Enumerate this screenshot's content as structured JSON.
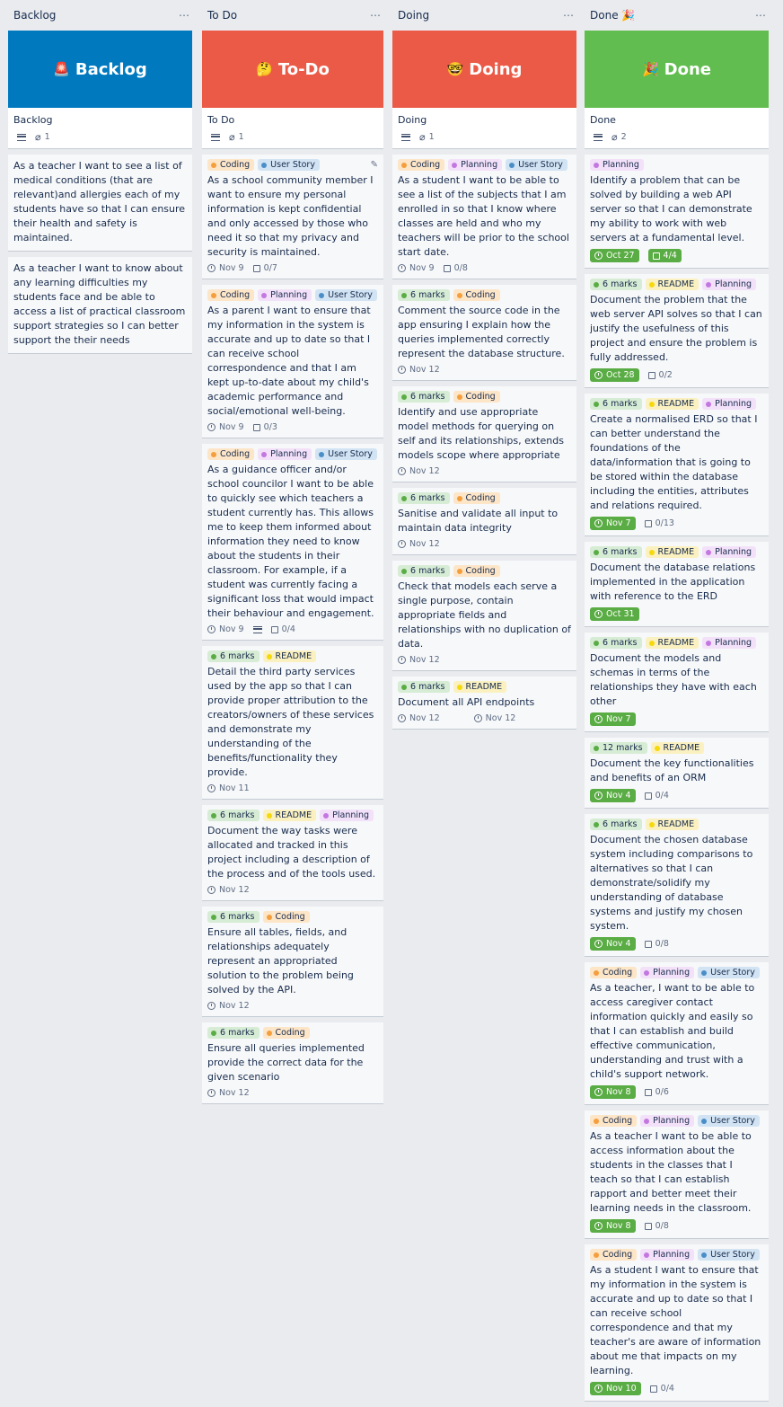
{
  "columns": [
    {
      "name": "Backlog",
      "cover": {
        "emoji": "🚨",
        "title": "Backlog",
        "color": "#0079bf"
      },
      "head_card": {
        "title": "Backlog",
        "attachments": "1"
      },
      "cards": [
        {
          "title": "As a teacher I want to see a list of medical conditions (that are relevant)and allergies each of my students have so that I can ensure their health and safety is maintained."
        },
        {
          "title": "As a teacher I want to know about any learning difficulties my students face and be able to access a list of practical classroom support strategies so I can better support the their needs"
        }
      ]
    },
    {
      "name": "To Do",
      "cover": {
        "emoji": "🤔",
        "title": "To-Do",
        "color": "#eb5a46"
      },
      "head_card": {
        "title": "To Do",
        "attachments": "1"
      },
      "cards": [
        {
          "labels": [
            "Coding",
            "User Story"
          ],
          "title": "As a school community member I want to ensure my personal information is kept confidential and only accessed by those who need it so that my privacy and security is maintained.",
          "date": "Nov 9",
          "checklist": "0/7"
        },
        {
          "labels": [
            "Coding",
            "Planning",
            "User Story"
          ],
          "title": "As a parent I want to ensure that my information in the system is accurate and up to date so that I can receive school correspondence and that I am kept up-to-date about my child's academic performance and social/emotional well-being.",
          "date": "Nov 9",
          "checklist": "0/3"
        },
        {
          "labels": [
            "Coding",
            "Planning",
            "User Story"
          ],
          "title": "As a guidance officer and/or school councilor I want to be able to quickly see which teachers a student currently has. This allows me to keep them informed about information they need to know about the students in their classroom. For example, if a student was currently facing a significant loss that would impact their behaviour and engagement.",
          "date": "Nov 9",
          "checklist": "0/4"
        },
        {
          "labels": [
            "6 marks",
            "README"
          ],
          "title": "Detail the third party services used by the app so that I can provide proper attribution to the creators/owners of these services and demonstrate my understanding of the benefits/functionality they provide.",
          "date": "Nov 11"
        },
        {
          "labels": [
            "6 marks",
            "README",
            "Planning"
          ],
          "title": "Document the way tasks were allocated and tracked in this project including a description of the process and of the tools used.",
          "date": "Nov 12"
        },
        {
          "labels": [
            "6 marks",
            "Coding"
          ],
          "title": "Ensure all tables, fields, and relationships adequately represent an appropriated solution to the problem being solved by the API.",
          "date": "Nov 12"
        },
        {
          "labels": [
            "6 marks",
            "Coding"
          ],
          "title": "Ensure all queries implemented provide the correct data for the given scenario",
          "date": "Nov 12"
        }
      ]
    },
    {
      "name": "Doing",
      "cover": {
        "emoji": "🤓",
        "title": "Doing",
        "color": "#eb5a46"
      },
      "head_card": {
        "title": "Doing",
        "attachments": "1"
      },
      "cards": [
        {
          "labels": [
            "Coding",
            "Planning",
            "User Story"
          ],
          "title": "As a student I want to be able to see a list of the subjects that I am enrolled in so that I know where classes are held and who my teachers will be prior to the school start date.",
          "date": "Nov 9",
          "checklist": "0/8"
        },
        {
          "labels": [
            "6 marks",
            "Coding"
          ],
          "title": "Comment the source code in the app ensuring I explain how the queries implemented correctly represent the database structure.",
          "date": "Nov 12"
        },
        {
          "labels": [
            "6 marks",
            "Coding"
          ],
          "title": "Identify and use appropriate model methods for querying on self and its relationships, extends models scope where appropriate",
          "date": "Nov 12"
        },
        {
          "labels": [
            "6 marks",
            "Coding"
          ],
          "title": "Sanitise and validate all input to maintain data integrity",
          "date": "Nov 12"
        },
        {
          "labels": [
            "6 marks",
            "Coding"
          ],
          "title": "Check that models each serve a single purpose, contain appropriate fields and relationships with no duplication of data.",
          "date": "Nov 12"
        },
        {
          "labels": [
            "6 marks",
            "README"
          ],
          "title": "Document all API endpoints",
          "date": "Nov 12",
          "date2": "Nov 12"
        }
      ]
    },
    {
      "name": "Done 🎉",
      "cover": {
        "emoji": "🎉",
        "title": "Done",
        "color": "#61bd4f"
      },
      "head_card": {
        "title": "Done",
        "attachments": "2"
      },
      "cards": [
        {
          "labels": [
            "Planning"
          ],
          "title": "Identify a problem that can be solved by building a web API server so that I can demonstrate my ability to work with web servers at a fundamental level.",
          "date": "Oct 27",
          "checklist": "4/4",
          "done": true,
          "check_done": true
        },
        {
          "labels": [
            "6 marks",
            "README",
            "Planning"
          ],
          "title": "Document the problem that the web server API solves so that I can justify the usefulness of this project and ensure the problem is fully addressed.",
          "date": "Oct 28",
          "checklist": "0/2",
          "done": true
        },
        {
          "labels": [
            "6 marks",
            "README",
            "Planning"
          ],
          "title": "Create a normalised ERD so that I can better understand the foundations of the data/information that is going to be stored within the database including the entities, attributes and relations required.",
          "date": "Nov 7",
          "checklist": "0/13",
          "done": true
        },
        {
          "labels": [
            "6 marks",
            "README",
            "Planning"
          ],
          "title": "Document the database relations implemented in the application with reference to the ERD",
          "date": "Oct 31",
          "done": true
        },
        {
          "labels": [
            "6 marks",
            "README",
            "Planning"
          ],
          "title": "Document the models and schemas in terms of the relationships they have with each other",
          "date": "Nov 7",
          "done": true
        },
        {
          "labels": [
            "12 marks",
            "README"
          ],
          "title": "Document the key functionalities and benefits of an ORM",
          "date": "Nov 4",
          "checklist": "0/4",
          "done": true
        },
        {
          "labels": [
            "6 marks",
            "README"
          ],
          "title": "Document the chosen database system including comparisons to alternatives so that I can demonstrate/solidify my understanding of database systems and justify my chosen system.",
          "date": "Nov 4",
          "checklist": "0/8",
          "done": true
        },
        {
          "labels": [
            "Coding",
            "Planning",
            "User Story"
          ],
          "title": "As a teacher, I want to be able to access caregiver contact information quickly and easily so that I can establish and build effective communication, understanding and trust with a child's support network.",
          "date": "Nov 8",
          "checklist": "0/6",
          "done": true
        },
        {
          "labels": [
            "Coding",
            "Planning",
            "User Story"
          ],
          "title": "As a teacher I want to be able to access information about the students in the classes that I teach so that I can establish rapport and better meet their learning needs in the classroom.",
          "date": "Nov 8",
          "checklist": "0/8",
          "done": true
        },
        {
          "labels": [
            "Coding",
            "Planning",
            "User Story"
          ],
          "title": "As a student I want to ensure that my information in the system is accurate and up to date so that I can receive school correspondence and that my teacher's are aware of information about me that impacts on my learning.",
          "date": "Nov 10",
          "checklist": "0/4",
          "done": true
        }
      ]
    }
  ],
  "ui": {
    "menu_glyph": "⋯",
    "clock_icon": "clock-icon",
    "checklist_icon": "checklist-icon"
  }
}
